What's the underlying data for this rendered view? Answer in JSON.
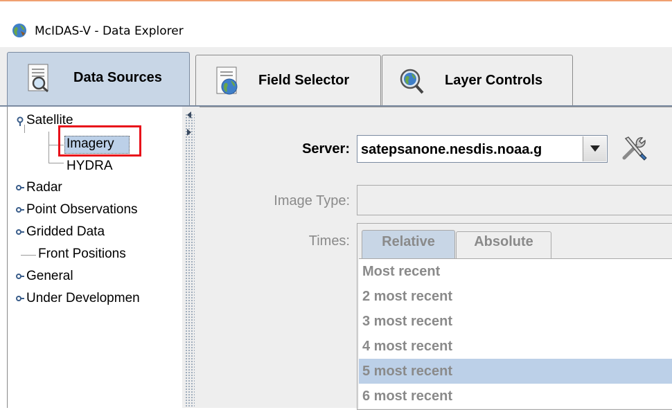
{
  "window": {
    "title": "McIDAS-V - Data Explorer"
  },
  "tabs": [
    {
      "label": "Data Sources",
      "icon": "magnifier-document-icon",
      "active": true
    },
    {
      "label": "Field Selector",
      "icon": "globe-document-icon",
      "active": false
    },
    {
      "label": "Layer Controls",
      "icon": "globe-magnifier-icon",
      "active": false
    }
  ],
  "tree": {
    "items": [
      {
        "label": "Satellite",
        "expanded": true
      },
      {
        "label": "Imagery",
        "selected": true
      },
      {
        "label": "HYDRA"
      },
      {
        "label": "Radar"
      },
      {
        "label": "Point Observations"
      },
      {
        "label": "Gridded Data"
      },
      {
        "label": "Front Positions"
      },
      {
        "label": "General"
      },
      {
        "label": "Under Developmen"
      }
    ]
  },
  "form": {
    "server_label": "Server:",
    "server_value": "satepsanone.nesdis.noaa.g",
    "image_type_label": "Image Type:",
    "image_type_value": "",
    "times_label": "Times:",
    "times_tabs": [
      "Relative",
      "Absolute"
    ],
    "times_options": [
      "Most recent",
      "2 most recent",
      "3 most recent",
      "4 most recent",
      "5 most recent",
      "6 most recent"
    ],
    "times_selected": "5 most recent"
  },
  "colors": {
    "active_tab": "#c8d6e6",
    "selection": "#bcd0e8",
    "highlight_box": "#e8101a",
    "panel_bg": "#eeeeee",
    "disabled_text": "#8a8a8a"
  }
}
